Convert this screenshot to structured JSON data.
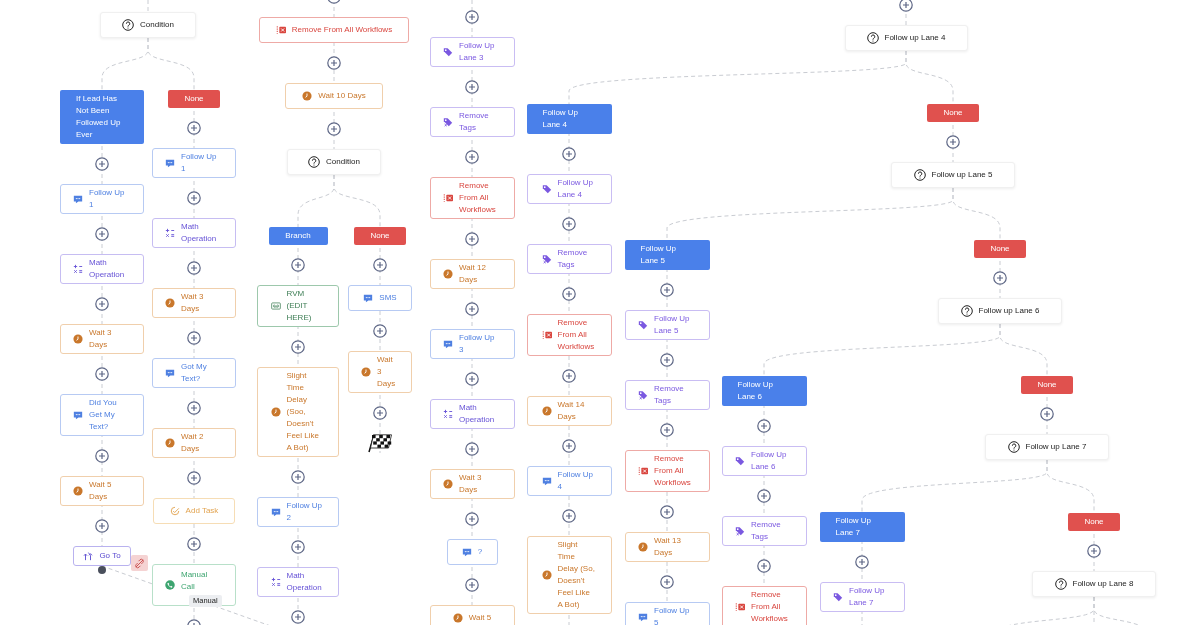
{
  "canvas": {
    "lanes": [
      {
        "steps": [
          {
            "kind": "condition",
            "text": "Condition"
          }
        ]
      },
      {
        "steps": [
          {
            "kind": "branch",
            "text": "If Lead Has Not Been Followed Up Ever"
          },
          {
            "kind": "add"
          },
          {
            "kind": "message",
            "text": "Follow Up 1"
          },
          {
            "kind": "add"
          },
          {
            "kind": "math",
            "text": "Math Operation"
          },
          {
            "kind": "add"
          },
          {
            "kind": "wait",
            "text": "Wait 3 Days"
          },
          {
            "kind": "add"
          },
          {
            "kind": "message",
            "text": "Did You Get My Text?"
          },
          {
            "kind": "add"
          },
          {
            "kind": "wait",
            "text": "Wait 5 Days"
          },
          {
            "kind": "add"
          },
          {
            "kind": "goto",
            "text": "Go To"
          }
        ]
      },
      {
        "steps": [
          {
            "kind": "none",
            "text": "None"
          },
          {
            "kind": "add"
          },
          {
            "kind": "message",
            "text": "Follow Up 1"
          },
          {
            "kind": "add"
          },
          {
            "kind": "math",
            "text": "Math Operation"
          },
          {
            "kind": "add"
          },
          {
            "kind": "wait",
            "text": "Wait 3 Days"
          },
          {
            "kind": "add"
          },
          {
            "kind": "message",
            "text": "Got My Text?"
          },
          {
            "kind": "add"
          },
          {
            "kind": "wait",
            "text": "Wait 2 Days"
          },
          {
            "kind": "add"
          },
          {
            "kind": "task",
            "text": "Add Task"
          },
          {
            "kind": "add"
          },
          {
            "kind": "call",
            "text": "Manual Call",
            "tooltip": "Manual"
          },
          {
            "kind": "add"
          }
        ]
      },
      {
        "steps": [
          {
            "kind": "add"
          },
          {
            "kind": "remove-workflows",
            "text": "Remove From All Workflows"
          },
          {
            "kind": "add"
          },
          {
            "kind": "wait",
            "text": "Wait 10 Days"
          },
          {
            "kind": "add"
          },
          {
            "kind": "condition",
            "text": "Condition"
          }
        ]
      },
      {
        "steps": [
          {
            "kind": "branch",
            "text": "Branch"
          },
          {
            "kind": "add"
          },
          {
            "kind": "rvm",
            "text": "RVM (EDIT HERE)"
          },
          {
            "kind": "add"
          },
          {
            "kind": "wait",
            "text": "Slight Time Delay (Soo, Doesn't Feel Like A Bot)"
          },
          {
            "kind": "add"
          },
          {
            "kind": "message",
            "text": "Follow Up 2"
          },
          {
            "kind": "add"
          },
          {
            "kind": "math",
            "text": "Math Operation"
          },
          {
            "kind": "add"
          }
        ]
      },
      {
        "steps": [
          {
            "kind": "none",
            "text": "None"
          },
          {
            "kind": "add"
          },
          {
            "kind": "message",
            "text": "SMS"
          },
          {
            "kind": "add"
          },
          {
            "kind": "wait",
            "text": "Wait 3 Days"
          },
          {
            "kind": "add"
          },
          {
            "kind": "finish"
          }
        ]
      },
      {
        "steps": [
          {
            "kind": "add"
          },
          {
            "kind": "tag",
            "text": "Follow Up Lane 3"
          },
          {
            "kind": "add"
          },
          {
            "kind": "remove-tags",
            "text": "Remove Tags"
          },
          {
            "kind": "add"
          },
          {
            "kind": "remove-workflows",
            "text": "Remove From All Workflows"
          },
          {
            "kind": "add"
          },
          {
            "kind": "wait",
            "text": "Wait 12 Days"
          },
          {
            "kind": "add"
          },
          {
            "kind": "message",
            "text": "Follow Up 3"
          },
          {
            "kind": "add"
          },
          {
            "kind": "math",
            "text": "Math Operation"
          },
          {
            "kind": "add"
          },
          {
            "kind": "wait",
            "text": "Wait 3 Days"
          },
          {
            "kind": "add"
          },
          {
            "kind": "message",
            "text": "?"
          },
          {
            "kind": "add"
          },
          {
            "kind": "wait",
            "text": "Wait 5"
          }
        ]
      },
      {
        "steps": [
          {
            "kind": "branch",
            "text": "Follow Up Lane 4"
          },
          {
            "kind": "add"
          },
          {
            "kind": "tag",
            "text": "Follow Up Lane 4"
          },
          {
            "kind": "add"
          },
          {
            "kind": "remove-tags",
            "text": "Remove Tags"
          },
          {
            "kind": "add"
          },
          {
            "kind": "remove-workflows",
            "text": "Remove From All Workflows"
          },
          {
            "kind": "add"
          },
          {
            "kind": "wait",
            "text": "Wait 14 Days"
          },
          {
            "kind": "add"
          },
          {
            "kind": "message",
            "text": "Follow Up 4"
          },
          {
            "kind": "add"
          },
          {
            "kind": "wait",
            "text": "Slight Time Delay (So, Doesn't Feel Like A Bot)"
          }
        ]
      },
      {
        "steps": [
          {
            "kind": "branch",
            "text": "Follow Up Lane 5"
          },
          {
            "kind": "add"
          },
          {
            "kind": "tag",
            "text": "Follow Up Lane 5"
          },
          {
            "kind": "add"
          },
          {
            "kind": "remove-tags",
            "text": "Remove Tags"
          },
          {
            "kind": "add"
          },
          {
            "kind": "remove-workflows",
            "text": "Remove From All Workflows"
          },
          {
            "kind": "add"
          },
          {
            "kind": "wait",
            "text": "Wait 13 Days"
          },
          {
            "kind": "add"
          },
          {
            "kind": "message",
            "text": "Follow Up 5"
          }
        ]
      },
      {
        "steps": [
          {
            "kind": "branch",
            "text": "Follow Up Lane 6"
          },
          {
            "kind": "add"
          },
          {
            "kind": "tag",
            "text": "Follow Up Lane 6"
          },
          {
            "kind": "add"
          },
          {
            "kind": "remove-tags",
            "text": "Remove Tags"
          },
          {
            "kind": "add"
          },
          {
            "kind": "remove-workflows",
            "text": "Remove From All Workflows"
          }
        ]
      },
      {
        "steps": [
          {
            "kind": "branch",
            "text": "Follow Up Lane 7"
          },
          {
            "kind": "add"
          },
          {
            "kind": "tag",
            "text": "Follow Up Lane 7"
          }
        ]
      },
      {
        "steps": [
          {
            "kind": "add"
          },
          {
            "kind": "condition",
            "text": "Follow up Lane 4"
          }
        ]
      },
      {
        "steps": [
          {
            "kind": "none",
            "text": "None"
          },
          {
            "kind": "add"
          },
          {
            "kind": "condition",
            "text": "Follow up Lane 5"
          }
        ]
      },
      {
        "steps": [
          {
            "kind": "none",
            "text": "None"
          },
          {
            "kind": "add"
          },
          {
            "kind": "condition",
            "text": "Follow up Lane 6"
          }
        ]
      },
      {
        "steps": [
          {
            "kind": "none",
            "text": "None"
          },
          {
            "kind": "add"
          },
          {
            "kind": "condition",
            "text": "Follow up Lane 7"
          }
        ]
      },
      {
        "steps": [
          {
            "kind": "none",
            "text": "None"
          },
          {
            "kind": "add"
          },
          {
            "kind": "condition",
            "text": "Follow up Lane 8"
          }
        ]
      }
    ]
  }
}
